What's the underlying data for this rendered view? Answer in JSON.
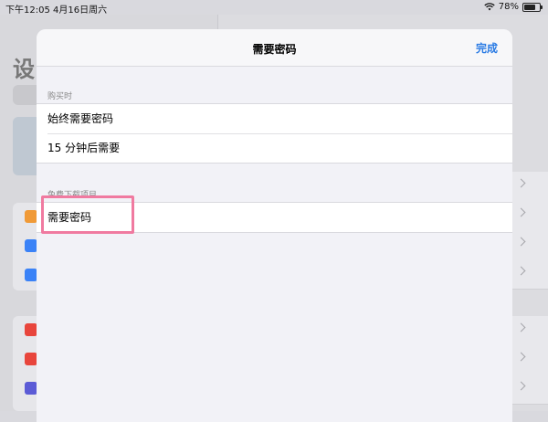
{
  "status_bar": {
    "time": "下午12:05",
    "date": "4月16日周六",
    "battery_percent": "78%",
    "battery_level": 0.78
  },
  "background": {
    "left_title": "设"
  },
  "sheet": {
    "title": "需要密码",
    "done_label": "完成",
    "sections": [
      {
        "header": "购买时",
        "rows": [
          "始终需要密码",
          "15 分钟后需要"
        ]
      },
      {
        "header": "免费下载项目",
        "rows": [
          "需要密码"
        ]
      }
    ]
  },
  "colors": {
    "accent": "#2a7be4",
    "highlight": "#f07aa0"
  }
}
